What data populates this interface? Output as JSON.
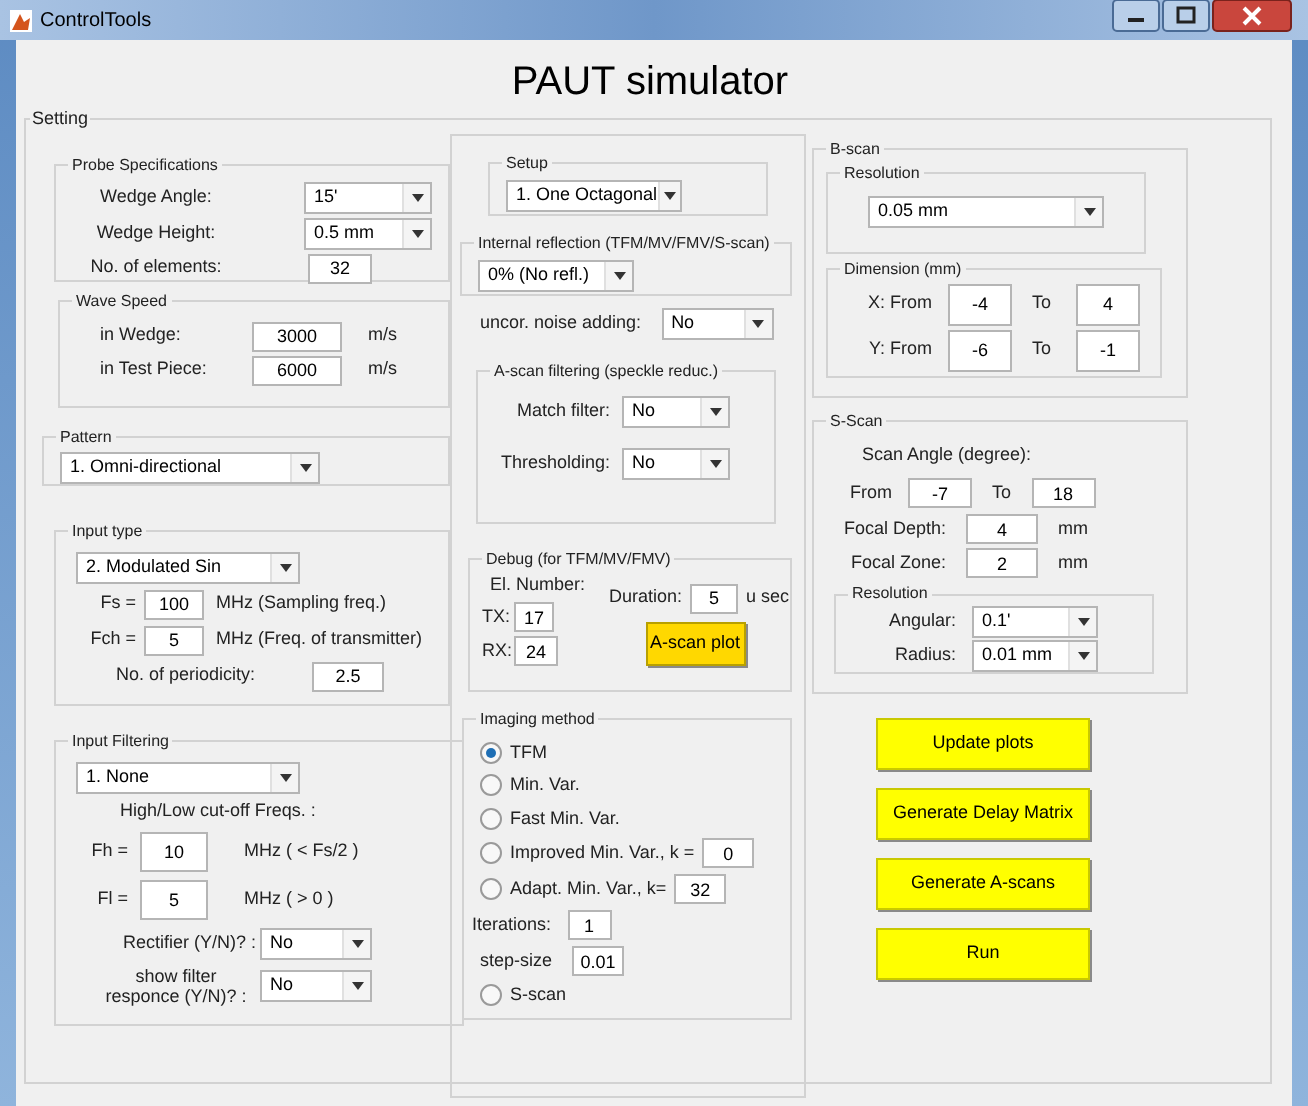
{
  "window": {
    "title": "ControlTools"
  },
  "app_title": "PAUT simulator",
  "setting": {
    "title": "Setting"
  },
  "probe": {
    "title": "Probe Specifications",
    "wedge_angle": {
      "label": "Wedge Angle:",
      "value": "15'"
    },
    "wedge_height": {
      "label": "Wedge Height:",
      "value": "0.5 mm"
    },
    "elements": {
      "label": "No. of elements:",
      "value": "32"
    }
  },
  "wave_speed": {
    "title": "Wave Speed",
    "wedge": {
      "label": "in Wedge:",
      "value": "3000",
      "unit": "m/s"
    },
    "test_piece": {
      "label": "in Test Piece:",
      "value": "6000",
      "unit": "m/s"
    }
  },
  "pattern": {
    "title": "Pattern",
    "value": "1. Omni-directional"
  },
  "input_type": {
    "title": "Input type",
    "value": "2. Modulated Sin",
    "fs": {
      "label": "Fs =",
      "value": "100",
      "unit": "MHz (Sampling freq.)"
    },
    "fch": {
      "label": "Fch =",
      "value": "5",
      "unit": "MHz (Freq. of transmitter)"
    },
    "periodicity": {
      "label": "No. of periodicity:",
      "value": "2.5"
    }
  },
  "input_filtering": {
    "title": "Input Filtering",
    "value": "1. None",
    "cutoff_label": "High/Low cut-off Freqs. :",
    "fh": {
      "label": "Fh =",
      "value": "10",
      "unit": "MHz  ( < Fs/2 )"
    },
    "fl": {
      "label": "Fl =",
      "value": "5",
      "unit": "MHz  ( > 0 )"
    },
    "rectifier": {
      "label": "Rectifier (Y/N)? :",
      "value": "No"
    },
    "show_response": {
      "label": "show filter responce (Y/N)? :",
      "value": "No"
    }
  },
  "setup": {
    "title": "Setup",
    "value": "1. One Octagonal"
  },
  "internal_reflection": {
    "title": "Internal reflection (TFM/MV/FMV/S-scan)",
    "value": "0% (No refl.)"
  },
  "noise": {
    "label": "uncor. noise adding:",
    "value": "No"
  },
  "ascan_filtering": {
    "title": "A-scan filtering (speckle reduc.)",
    "match": {
      "label": "Match filter:",
      "value": "No"
    },
    "threshold": {
      "label": "Thresholding:",
      "value": "No"
    }
  },
  "debug": {
    "title": "Debug (for TFM/MV/FMV)",
    "el_label": "El. Number:",
    "tx": {
      "label": "TX:",
      "value": "17"
    },
    "rx": {
      "label": "RX:",
      "value": "24"
    },
    "duration": {
      "label": "Duration:",
      "value": "5",
      "unit": "u sec"
    },
    "button": "A-scan plot"
  },
  "imaging": {
    "title": "Imaging method",
    "methods": [
      {
        "label": "TFM",
        "selected": true
      },
      {
        "label": "Min. Var.",
        "selected": false
      },
      {
        "label": "Fast Min. Var.",
        "selected": false
      },
      {
        "label": "Improved Min. Var.,  k =",
        "selected": false,
        "value": "0"
      },
      {
        "label": "Adapt. Min. Var., k=",
        "selected": false,
        "value": "32"
      },
      {
        "label": "S-scan",
        "selected": false
      }
    ],
    "iterations": {
      "label": "Iterations:",
      "value": "1"
    },
    "step_size": {
      "label": "step-size",
      "value": "0.01"
    }
  },
  "bscan": {
    "title": "B-scan",
    "resolution": {
      "title": "Resolution",
      "value": "0.05 mm"
    },
    "dimension": {
      "title": "Dimension (mm)",
      "x": {
        "label": "X: From",
        "from": "-4",
        "to_label": "To",
        "to": "4"
      },
      "y": {
        "label": "Y: From",
        "from": "-6",
        "to_label": "To",
        "to": "-1"
      }
    }
  },
  "sscan": {
    "title": "S-Scan",
    "angle_label": "Scan Angle (degree):",
    "from": {
      "label": "From",
      "value": "-7"
    },
    "to": {
      "label": "To",
      "value": "18"
    },
    "focal_depth": {
      "label": "Focal Depth:",
      "value": "4",
      "unit": "mm"
    },
    "focal_zone": {
      "label": "Focal Zone:",
      "value": "2",
      "unit": "mm"
    },
    "resolution": {
      "title": "Resolution",
      "angular": {
        "label": "Angular:",
        "value": "0.1'"
      },
      "radius": {
        "label": "Radius:",
        "value": "0.01 mm"
      }
    }
  },
  "actions": [
    "Update plots",
    "Generate Delay Matrix",
    "Generate A-scans",
    "Run"
  ]
}
